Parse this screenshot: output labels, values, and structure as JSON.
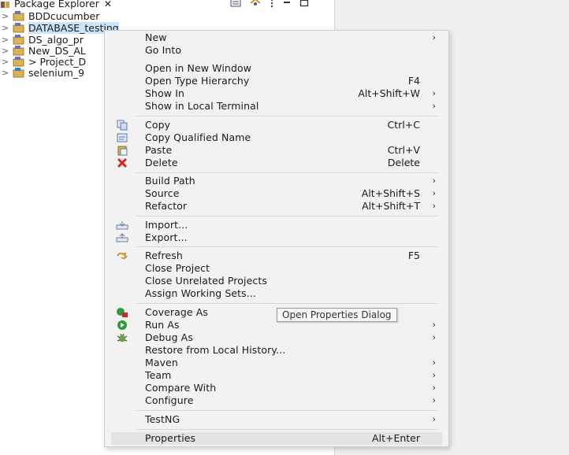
{
  "explorer": {
    "tab_title": "Package Explorer",
    "tab_close": "✕",
    "items": [
      {
        "label": "BDDcucumber"
      },
      {
        "label": "DATABASE_testing"
      },
      {
        "label": "DS_algo_pr"
      },
      {
        "label": "New_DS_AL"
      },
      {
        "label": "> Project_D"
      },
      {
        "label": "selenium_9"
      }
    ]
  },
  "menu": {
    "items": [
      {
        "label": "New",
        "accel": "",
        "arrow": "›"
      },
      {
        "label": "Go Into",
        "accel": "",
        "arrow": ""
      },
      {
        "label": "Open in New Window",
        "accel": "",
        "arrow": ""
      },
      {
        "label": "Open Type Hierarchy",
        "accel": "F4",
        "arrow": ""
      },
      {
        "label": "Show In",
        "accel": "Alt+Shift+W",
        "arrow": "›"
      },
      {
        "label": "Show in Local Terminal",
        "accel": "",
        "arrow": "›"
      },
      {
        "label": "Copy",
        "accel": "Ctrl+C",
        "arrow": ""
      },
      {
        "label": "Copy Qualified Name",
        "accel": "",
        "arrow": ""
      },
      {
        "label": "Paste",
        "accel": "Ctrl+V",
        "arrow": ""
      },
      {
        "label": "Delete",
        "accel": "Delete",
        "arrow": ""
      },
      {
        "label": "Build Path",
        "accel": "",
        "arrow": "›"
      },
      {
        "label": "Source",
        "accel": "Alt+Shift+S",
        "arrow": "›"
      },
      {
        "label": "Refactor",
        "accel": "Alt+Shift+T",
        "arrow": "›"
      },
      {
        "label": "Import...",
        "accel": "",
        "arrow": ""
      },
      {
        "label": "Export...",
        "accel": "",
        "arrow": ""
      },
      {
        "label": "Refresh",
        "accel": "F5",
        "arrow": ""
      },
      {
        "label": "Close Project",
        "accel": "",
        "arrow": ""
      },
      {
        "label": "Close Unrelated Projects",
        "accel": "",
        "arrow": ""
      },
      {
        "label": "Assign Working Sets...",
        "accel": "",
        "arrow": ""
      },
      {
        "label": "Coverage As",
        "accel": "",
        "arrow": ""
      },
      {
        "label": "Run As",
        "accel": "",
        "arrow": "›"
      },
      {
        "label": "Debug As",
        "accel": "",
        "arrow": "›"
      },
      {
        "label": "Restore from Local History...",
        "accel": "",
        "arrow": ""
      },
      {
        "label": "Maven",
        "accel": "",
        "arrow": "›"
      },
      {
        "label": "Team",
        "accel": "",
        "arrow": "›"
      },
      {
        "label": "Compare With",
        "accel": "",
        "arrow": "›"
      },
      {
        "label": "Configure",
        "accel": "",
        "arrow": "›"
      },
      {
        "label": "TestNG",
        "accel": "",
        "arrow": "›"
      },
      {
        "label": "Properties",
        "accel": "Alt+Enter",
        "arrow": ""
      }
    ]
  },
  "tooltip": {
    "text": "Open Properties Dialog"
  },
  "colors": {
    "selection": "#cce4f7",
    "menu_bg": "#f2f2f2",
    "hover_bg": "#e3e3e3",
    "delete_red": "#d9251d",
    "run_green": "#2e9a3a"
  }
}
